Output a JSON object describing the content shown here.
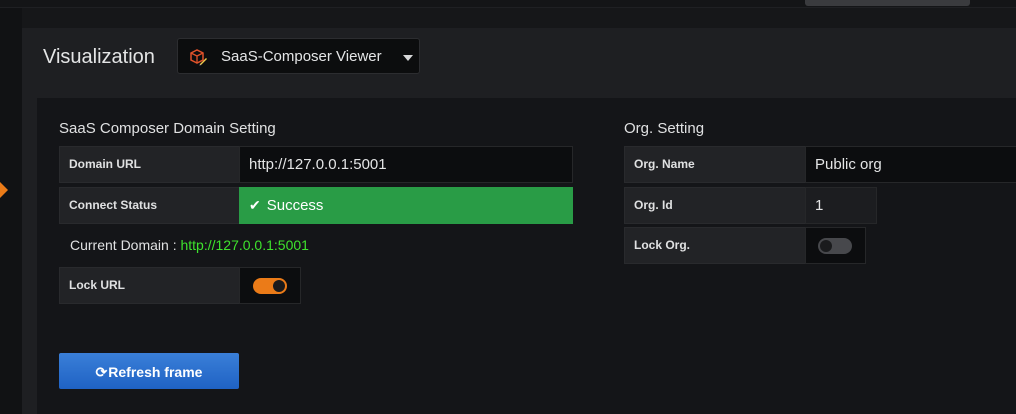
{
  "visualization": {
    "title": "Visualization",
    "selected_plugin": "SaaS-Composer Viewer",
    "plugin_icon": "cube-pencil-icon"
  },
  "domain_section": {
    "title": "SaaS Composer Domain Setting",
    "domain_url_label": "Domain URL",
    "domain_url_value": "http://127.0.0.1:5001",
    "connect_status_label": "Connect Status",
    "connect_status_value": "Success",
    "current_domain_label": "Current Domain :",
    "current_domain_value": "http://127.0.0.1:5001",
    "lock_url_label": "Lock URL",
    "lock_url_enabled": true
  },
  "org_section": {
    "title": "Org. Setting",
    "org_name_label": "Org. Name",
    "org_name_value": "Public org",
    "org_id_label": "Org. Id",
    "org_id_value": "1",
    "lock_org_label": "Lock Org.",
    "lock_org_enabled": false
  },
  "actions": {
    "refresh_label": "Refresh frame",
    "refresh_icon": "refresh-icon"
  },
  "colors": {
    "accent_orange": "#eb7b18",
    "success_green": "#299c46",
    "domain_link_green": "#3ee32d",
    "primary_blue": "#1f62c4"
  }
}
